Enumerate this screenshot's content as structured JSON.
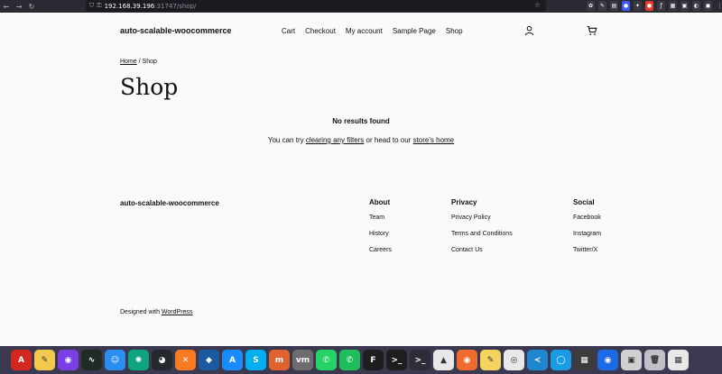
{
  "browser": {
    "url_host": "192.168.39.196",
    "url_rest": ":31747/shop/",
    "nav_back": "←",
    "nav_forward": "→",
    "nav_reload": "↻",
    "star": "☆",
    "shield": "⛉",
    "lock": "⚿",
    "extensions": [
      {
        "label": "✿",
        "color": "#3a3a44"
      },
      {
        "label": "✎",
        "color": "#3a3a44"
      },
      {
        "label": "▤",
        "color": "#3a3a44"
      },
      {
        "label": "●",
        "color": "#3d5afe"
      },
      {
        "label": "✦",
        "color": "#3a3a44"
      },
      {
        "label": "●",
        "color": "#e33b2e"
      },
      {
        "label": "ƒ",
        "color": "#3a3a44"
      },
      {
        "label": "▦",
        "color": "#3a3a44"
      },
      {
        "label": "▣",
        "color": "#3a3a44"
      },
      {
        "label": "◐",
        "color": "#3a3a44"
      },
      {
        "label": "◼",
        "color": "#3a3a44"
      },
      {
        "label": "⋮",
        "color": "#2b2a33"
      }
    ]
  },
  "header": {
    "site_title": "auto-scalable-woocommerce",
    "nav": [
      "Cart",
      "Checkout",
      "My account",
      "Sample Page",
      "Shop"
    ]
  },
  "breadcrumb": {
    "home": "Home",
    "separator": " / ",
    "current": "Shop"
  },
  "page_title": "Shop",
  "results": {
    "heading": "No results found",
    "hint_prefix": "You can try ",
    "hint_link1": "clearing any filters",
    "hint_middle": " or head to our ",
    "hint_link2": "store's home"
  },
  "footer": {
    "brand": "auto-scalable-woocommerce",
    "columns": [
      {
        "title": "About",
        "links": [
          "Team",
          "History",
          "Careers"
        ]
      },
      {
        "title": "Privacy",
        "links": [
          "Privacy Policy",
          "Terms and Conditions",
          "Contact Us"
        ]
      },
      {
        "title": "Social",
        "links": [
          "Facebook",
          "Instagram",
          "Twitter/X"
        ]
      }
    ],
    "designed_prefix": "Designed with ",
    "designed_link": "WordPress"
  },
  "dock": [
    {
      "name": "acrobat",
      "label": "A",
      "color": "#d4271f"
    },
    {
      "name": "notes",
      "label": "✎",
      "color": "#f2c94c"
    },
    {
      "name": "firefox-dev",
      "label": "◉",
      "color": "#7b3fe4"
    },
    {
      "name": "activity",
      "label": "∿",
      "color": "#1f2b24"
    },
    {
      "name": "finder",
      "label": "☺",
      "color": "#2a8ef0"
    },
    {
      "name": "chatgpt",
      "label": "✺",
      "color": "#10a37f"
    },
    {
      "name": "github",
      "label": "◕",
      "color": "#24292e"
    },
    {
      "name": "xampp",
      "label": "✕",
      "color": "#fb7a24"
    },
    {
      "name": "mysql",
      "label": "◆",
      "color": "#1c5aa0"
    },
    {
      "name": "appstore",
      "label": "A",
      "color": "#1a8cff"
    },
    {
      "name": "skype",
      "label": "S",
      "color": "#00aff0"
    },
    {
      "name": "mamp",
      "label": "m",
      "color": "#e0622f"
    },
    {
      "name": "vm",
      "label": "vm",
      "color": "#6d6d6d"
    },
    {
      "name": "whatsapp",
      "label": "✆",
      "color": "#25d366"
    },
    {
      "name": "whatsapp2",
      "label": "✆",
      "color": "#1ebe5a"
    },
    {
      "name": "figma",
      "label": "F",
      "color": "#1e1e1e"
    },
    {
      "name": "terminal",
      "label": ">_",
      "color": "#1e1e1e"
    },
    {
      "name": "terminal2",
      "label": ">_",
      "color": "#2d2d3a"
    },
    {
      "name": "android",
      "label": "▲",
      "color": "#e8e8e8"
    },
    {
      "name": "postman",
      "label": "◉",
      "color": "#ef6c2e"
    },
    {
      "name": "stickies",
      "label": "✎",
      "color": "#f4d35e"
    },
    {
      "name": "chrome",
      "label": "◎",
      "color": "#e9e9e9"
    },
    {
      "name": "vscode",
      "label": "≺",
      "color": "#1f86d0"
    },
    {
      "name": "onedrive",
      "label": "◯",
      "color": "#1b9be4"
    },
    {
      "name": "calculator",
      "label": "▦",
      "color": "#3c3c3c"
    },
    {
      "name": "firefox",
      "label": "◉",
      "color": "#1d6ae5"
    },
    {
      "name": "preview",
      "label": "▣",
      "color": "#d0d0d0"
    },
    {
      "name": "trash",
      "label": "🗑",
      "color": "#c0c0c8"
    },
    {
      "name": "launchpad",
      "label": "▦",
      "color": "#e8e8e8"
    }
  ]
}
